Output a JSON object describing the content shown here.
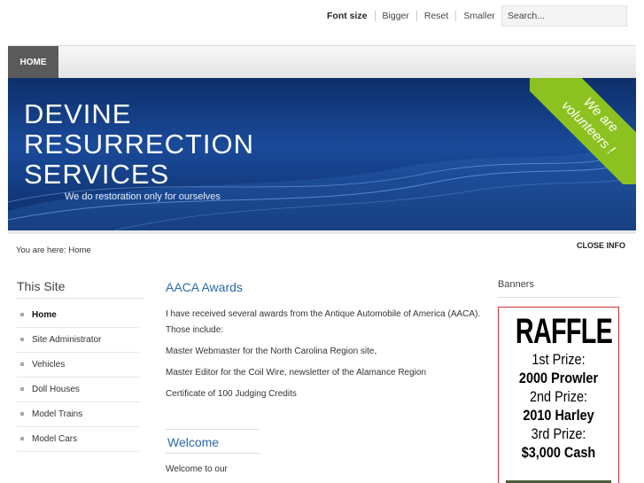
{
  "toolbar": {
    "font_size_label": "Font size",
    "bigger": "Bigger",
    "reset": "Reset",
    "smaller": "Smaller",
    "search_value": "Search..."
  },
  "nav": {
    "home": "HOME"
  },
  "header": {
    "title_lines": [
      "DEVINE",
      "RESURRECTION",
      "SERVICES"
    ],
    "tagline": "We do restoration only for ourselves",
    "ribbon_lines": [
      "We are",
      "volunteers !"
    ],
    "ribbon_color": "#8cc21f",
    "banner_color": "#1a4a9a"
  },
  "breadcrumb": {
    "text": "You are here: Home"
  },
  "close_info": "CLOSE INFO",
  "left": {
    "title": "This Site",
    "items": [
      "Home",
      "Site Administrator",
      "Vehicles",
      "Doll Houses",
      "Model Trains",
      "Model Cars"
    ]
  },
  "main": {
    "heading": "AACA Awards",
    "paragraphs": [
      "I have received several awards from the Antique Automobile of America (AACA). Those include:",
      "Master Webmaster for the North Carolina Region site,",
      "Master Editor for the Coil Wire, newsletter of the Alamance Region",
      "Certificate of 100 Judging Credits"
    ],
    "welcome_heading": "Welcome",
    "welcome_text": "Welcome to our"
  },
  "right": {
    "title": "Banners",
    "raffle": {
      "title": "RAFFLE",
      "lines": [
        {
          "kind": "prize",
          "text": "1st Prize:"
        },
        {
          "kind": "item",
          "text": "2000 Prowler"
        },
        {
          "kind": "prize",
          "text": "2nd Prize:"
        },
        {
          "kind": "item",
          "text": "2010 Harley"
        },
        {
          "kind": "prize",
          "text": "3rd Prize:"
        },
        {
          "kind": "item",
          "text": "$3,000 Cash"
        }
      ]
    }
  }
}
